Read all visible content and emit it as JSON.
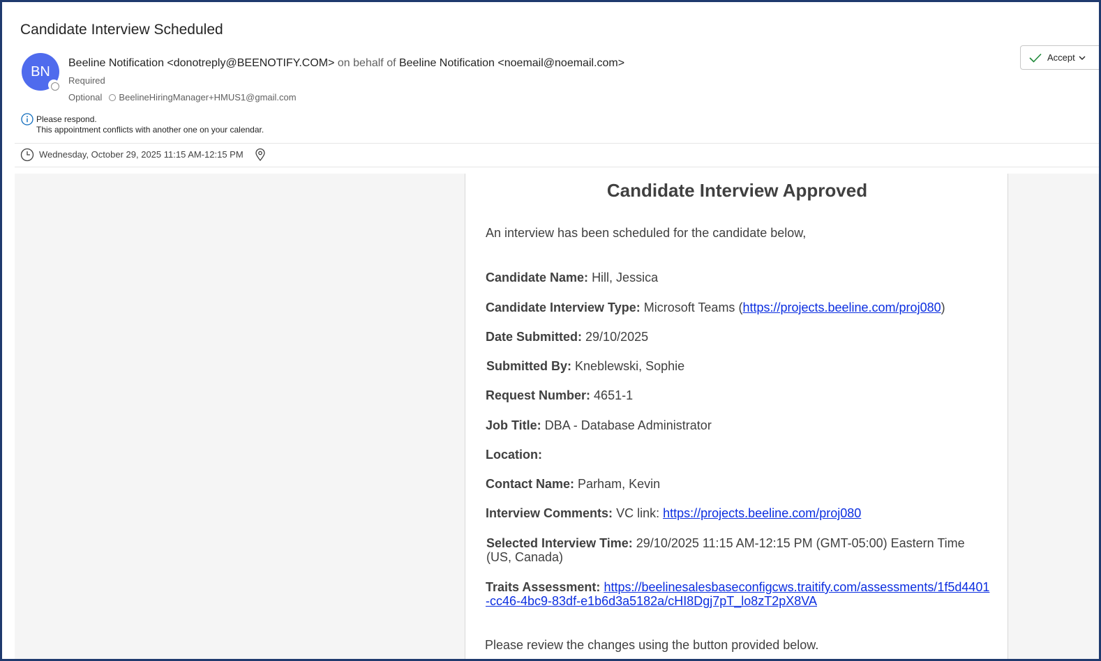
{
  "email": {
    "subject": "Candidate Interview Scheduled",
    "avatar_initials": "BN",
    "from_sender": "Beeline Notification <donotreply@BEENOTIFY.COM>",
    "from_behalf": "on behalf of",
    "from_principal": "Beeline Notification <noemail@noemail.com>",
    "required_label": "Required",
    "optional_label": "Optional",
    "optional_attendee": "BeelineHiringManager+HMUS1@gmail.com",
    "accept_label": "Accept",
    "info_line1": "Please respond.",
    "info_line2": "This appointment conflicts with another one on your calendar.",
    "datetime": "Wednesday, October 29, 2025 11:15 AM-12:15 PM",
    "accent_color": "#4f6bed"
  },
  "body": {
    "heading": "Candidate Interview Approved",
    "intro": "An interview has been scheduled for the candidate below,",
    "candidate_name_label": "Candidate Name:",
    "candidate_name": "Hill, Jessica",
    "interview_type_label": "Candidate Interview Type:",
    "interview_type_prefix": "Microsoft Teams (",
    "interview_type_link": "https://projects.beeline.com/proj080",
    "interview_type_suffix": ")",
    "date_submitted_label": "Date Submitted:",
    "date_submitted": "29/10/2025",
    "submitted_by_label": "Submitted By:",
    "submitted_by": "Kneblewski, Sophie",
    "request_number_label": "Request Number:",
    "request_number": "4651-1",
    "job_title_label": "Job Title:",
    "job_title": "DBA - Database Administrator",
    "location_label": "Location:",
    "location": "",
    "contact_name_label": "Contact Name:",
    "contact_name": "Parham, Kevin",
    "comments_label": "Interview Comments:",
    "comments_prefix": "VC link:",
    "comments_link": "https://projects.beeline.com/proj080",
    "selected_time_label": "Selected Interview Time:",
    "selected_time": "29/10/2025 11:15 AM-12:15 PM (GMT-05:00) Eastern Time (US, Canada)",
    "traits_label": "Traits Assessment:",
    "traits_link": "https://beelinesalesbaseconfigcws.traitify.com/assessments/1f5d4401-cc46-4bc9-83df-e1b6d3a5182a/cHI8Dgj7pT_lo8zT2pX8VA",
    "closing": "Please review the changes using the button provided below.",
    "link_color": "#0b2ee0"
  }
}
